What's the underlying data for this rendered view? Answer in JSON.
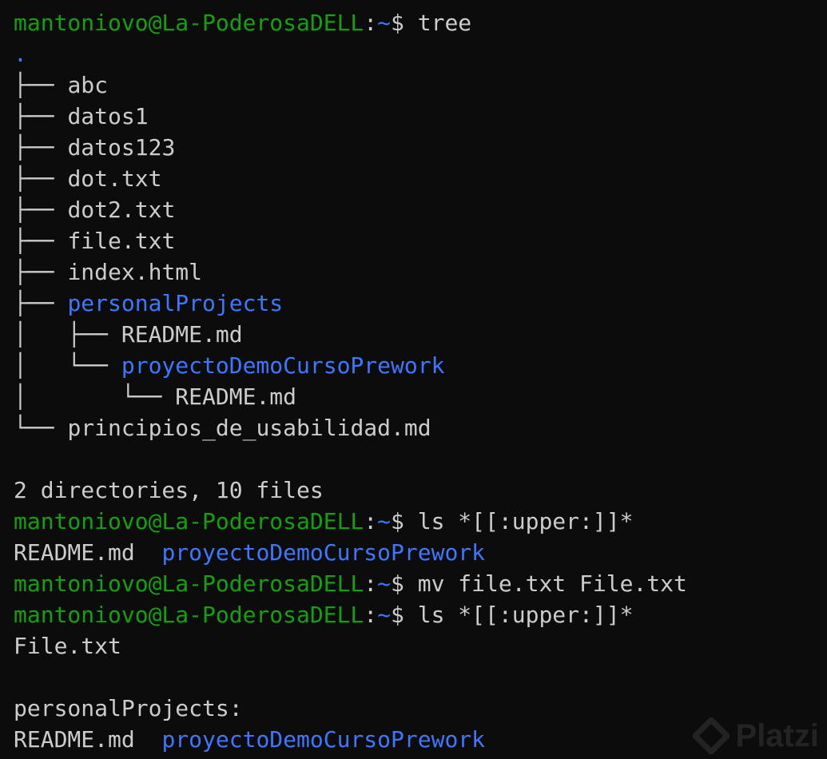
{
  "terminal": {
    "colors": {
      "background": "#0c0c0c",
      "text": "#cccccc",
      "prompt_user": "#13a10e",
      "prompt_path": "#3b78ff",
      "directory": "#3b78ff"
    },
    "lines": [
      {
        "kind": "prompt",
        "segs": [
          {
            "t": "mantoniovo@La-PoderosaDELL",
            "c": "user"
          },
          {
            "t": ":",
            "c": "colon"
          },
          {
            "t": "~",
            "c": "path"
          },
          {
            "t": "$ tree",
            "c": "cmd"
          }
        ]
      },
      {
        "kind": "tree-entry",
        "segs": [
          {
            "t": ".",
            "c": "dir"
          }
        ]
      },
      {
        "kind": "tree-entry",
        "segs": [
          {
            "t": "├── ",
            "c": "tree"
          },
          {
            "t": "abc",
            "c": "file"
          }
        ]
      },
      {
        "kind": "tree-entry",
        "segs": [
          {
            "t": "├── ",
            "c": "tree"
          },
          {
            "t": "datos1",
            "c": "file"
          }
        ]
      },
      {
        "kind": "tree-entry",
        "segs": [
          {
            "t": "├── ",
            "c": "tree"
          },
          {
            "t": "datos123",
            "c": "file"
          }
        ]
      },
      {
        "kind": "tree-entry",
        "segs": [
          {
            "t": "├── ",
            "c": "tree"
          },
          {
            "t": "dot.txt",
            "c": "file"
          }
        ]
      },
      {
        "kind": "tree-entry",
        "segs": [
          {
            "t": "├── ",
            "c": "tree"
          },
          {
            "t": "dot2.txt",
            "c": "file"
          }
        ]
      },
      {
        "kind": "tree-entry",
        "segs": [
          {
            "t": "├── ",
            "c": "tree"
          },
          {
            "t": "file.txt",
            "c": "file"
          }
        ]
      },
      {
        "kind": "tree-entry",
        "segs": [
          {
            "t": "├── ",
            "c": "tree"
          },
          {
            "t": "index.html",
            "c": "file"
          }
        ]
      },
      {
        "kind": "tree-entry",
        "segs": [
          {
            "t": "├── ",
            "c": "tree"
          },
          {
            "t": "personalProjects",
            "c": "dir"
          }
        ]
      },
      {
        "kind": "tree-entry",
        "segs": [
          {
            "t": "│   ├── ",
            "c": "tree"
          },
          {
            "t": "README.md",
            "c": "file"
          }
        ]
      },
      {
        "kind": "tree-entry",
        "segs": [
          {
            "t": "│   └── ",
            "c": "tree"
          },
          {
            "t": "proyectoDemoCursoPrework",
            "c": "dir"
          }
        ]
      },
      {
        "kind": "tree-entry",
        "segs": [
          {
            "t": "│       └── ",
            "c": "tree"
          },
          {
            "t": "README.md",
            "c": "file"
          }
        ]
      },
      {
        "kind": "tree-entry",
        "segs": [
          {
            "t": "└── ",
            "c": "tree"
          },
          {
            "t": "principios_de_usabilidad.md",
            "c": "file"
          }
        ]
      },
      {
        "kind": "blank",
        "segs": []
      },
      {
        "kind": "summary",
        "segs": [
          {
            "t": "2 directories, 10 files",
            "c": "summary"
          }
        ]
      },
      {
        "kind": "prompt",
        "segs": [
          {
            "t": "mantoniovo@La-PoderosaDELL",
            "c": "user"
          },
          {
            "t": ":",
            "c": "colon"
          },
          {
            "t": "~",
            "c": "path"
          },
          {
            "t": "$ ls *[[:upper:]]*",
            "c": "cmd"
          }
        ]
      },
      {
        "kind": "output",
        "segs": [
          {
            "t": "README.md  ",
            "c": "file"
          },
          {
            "t": "proyectoDemoCursoPrework",
            "c": "dir"
          }
        ]
      },
      {
        "kind": "prompt",
        "segs": [
          {
            "t": "mantoniovo@La-PoderosaDELL",
            "c": "user"
          },
          {
            "t": ":",
            "c": "colon"
          },
          {
            "t": "~",
            "c": "path"
          },
          {
            "t": "$ mv file.txt File.txt",
            "c": "cmd"
          }
        ]
      },
      {
        "kind": "prompt",
        "segs": [
          {
            "t": "mantoniovo@La-PoderosaDELL",
            "c": "user"
          },
          {
            "t": ":",
            "c": "colon"
          },
          {
            "t": "~",
            "c": "path"
          },
          {
            "t": "$ ls *[[:upper:]]*",
            "c": "cmd"
          }
        ]
      },
      {
        "kind": "output",
        "segs": [
          {
            "t": "File.txt",
            "c": "file"
          }
        ]
      },
      {
        "kind": "blank",
        "segs": []
      },
      {
        "kind": "output",
        "segs": [
          {
            "t": "personalProjects:",
            "c": "heading"
          }
        ]
      },
      {
        "kind": "output",
        "segs": [
          {
            "t": "README.md  ",
            "c": "file"
          },
          {
            "t": "proyectoDemoCursoPrework",
            "c": "dir"
          }
        ]
      }
    ]
  },
  "watermark": {
    "text": "Platzi",
    "icon": "platzi-logo-icon"
  }
}
